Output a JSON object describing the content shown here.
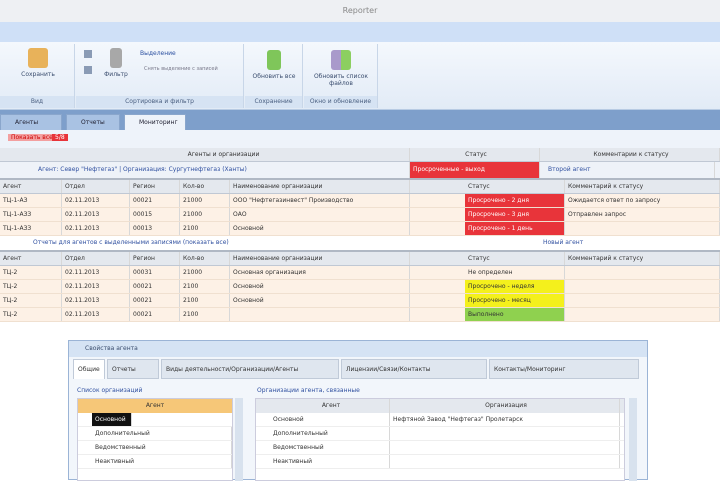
{
  "window": {
    "title": "Reporter"
  },
  "ribbon": {
    "buttons": [
      {
        "label": "Сохранить"
      },
      {
        "label": "Фильтр"
      },
      {
        "label": "Выделение"
      },
      {
        "label": "Снять выделение с записей"
      },
      {
        "label": "Обновить все"
      },
      {
        "label": "Обновить список файлов"
      }
    ],
    "groups": [
      "Вид",
      "Сортировка и фильтр",
      "Сохранение",
      "Окно и обновление"
    ]
  },
  "doc_tabs": [
    {
      "label": "Агенты"
    },
    {
      "label": "Отчеты"
    },
    {
      "label": "Мониторинг"
    }
  ],
  "toolbar": {
    "show_all": "Показать все",
    "badge": "5/8"
  },
  "grid1": {
    "group_headers": [
      "Агенты и организации",
      "Статус",
      "Комментарии к статусу"
    ],
    "filter_text": "Агент: Север \"Нефтегаз\" | Организация: Сургутнефтегаз (Ханты)",
    "filter_status": "Просроченные - выход",
    "filter_right": "Второй агент",
    "columns": [
      "Агент",
      "Отдел",
      "Регион",
      "Кол-во",
      "Наименование организации",
      "Статус",
      "Комментарий к статусу"
    ],
    "rows": [
      {
        "c": [
          "ТЦ-1-АЗ",
          "02.11.2013",
          "00021",
          "21000",
          "ООО \"Нефтегазинвест\" Производство",
          "Просрочено - 2 дня",
          "Ожидается ответ по запросу"
        ],
        "s": "red"
      },
      {
        "c": [
          "ТЦ-1-АЗЗ",
          "02.11.2013",
          "00015",
          "21000",
          "ОАО",
          "Просрочено - 3 дня",
          "Отправлен запрос"
        ],
        "s": "red"
      },
      {
        "c": [
          "ТЦ-1-АЗЗ",
          "02.11.2013",
          "00013",
          "2100",
          "Основной",
          "Просрочено - 1 день",
          ""
        ],
        "s": "red"
      }
    ],
    "separator_left": "Отчеты для агентов с выделенными записями (показать все)",
    "separator_right": "Новый агент"
  },
  "grid2": {
    "columns": [
      "Агент",
      "Отдел",
      "Регион",
      "Кол-во",
      "Наименование организации",
      "Статус",
      "Комментарий к статусу"
    ],
    "rows": [
      {
        "c": [
          "ТЦ-2",
          "02.11.2013",
          "00031",
          "21000",
          "Основная организация",
          "Не определен",
          ""
        ],
        "s": ""
      },
      {
        "c": [
          "ТЦ-2",
          "02.11.2013",
          "00021",
          "2100",
          "Основной",
          "Просрочено - неделя",
          ""
        ],
        "s": "yel"
      },
      {
        "c": [
          "ТЦ-2",
          "02.11.2013",
          "00021",
          "2100",
          "Основной",
          "Просрочено - месяц",
          ""
        ],
        "s": "yel"
      },
      {
        "c": [
          "ТЦ-2",
          "02.11.2013",
          "00021",
          "2100",
          "",
          "Выполнено",
          ""
        ],
        "s": "grn"
      }
    ]
  },
  "dialog": {
    "title": "Свойства агента",
    "tabs": [
      "Общие",
      "Отчеты",
      "Виды деятельности/Организации/Агенты",
      "Лицензии/Связи/Контакты",
      "Контакты/Мониторинг"
    ],
    "left": {
      "caption": "Список организаций",
      "header": "Агент",
      "rows": [
        "Основной",
        "Дополнительный",
        "Ведомственный",
        "Неактивный"
      ]
    },
    "right": {
      "caption": "Организации агента, связанные",
      "headers": [
        "Агент",
        "Организация"
      ],
      "rows": [
        [
          "Основной",
          "Нефтяной Завод \"Нефтегаз\" Пролетарск"
        ],
        [
          "Дополнительный",
          ""
        ],
        [
          "Ведомственный",
          ""
        ],
        [
          "Неактивный",
          ""
        ]
      ]
    }
  }
}
